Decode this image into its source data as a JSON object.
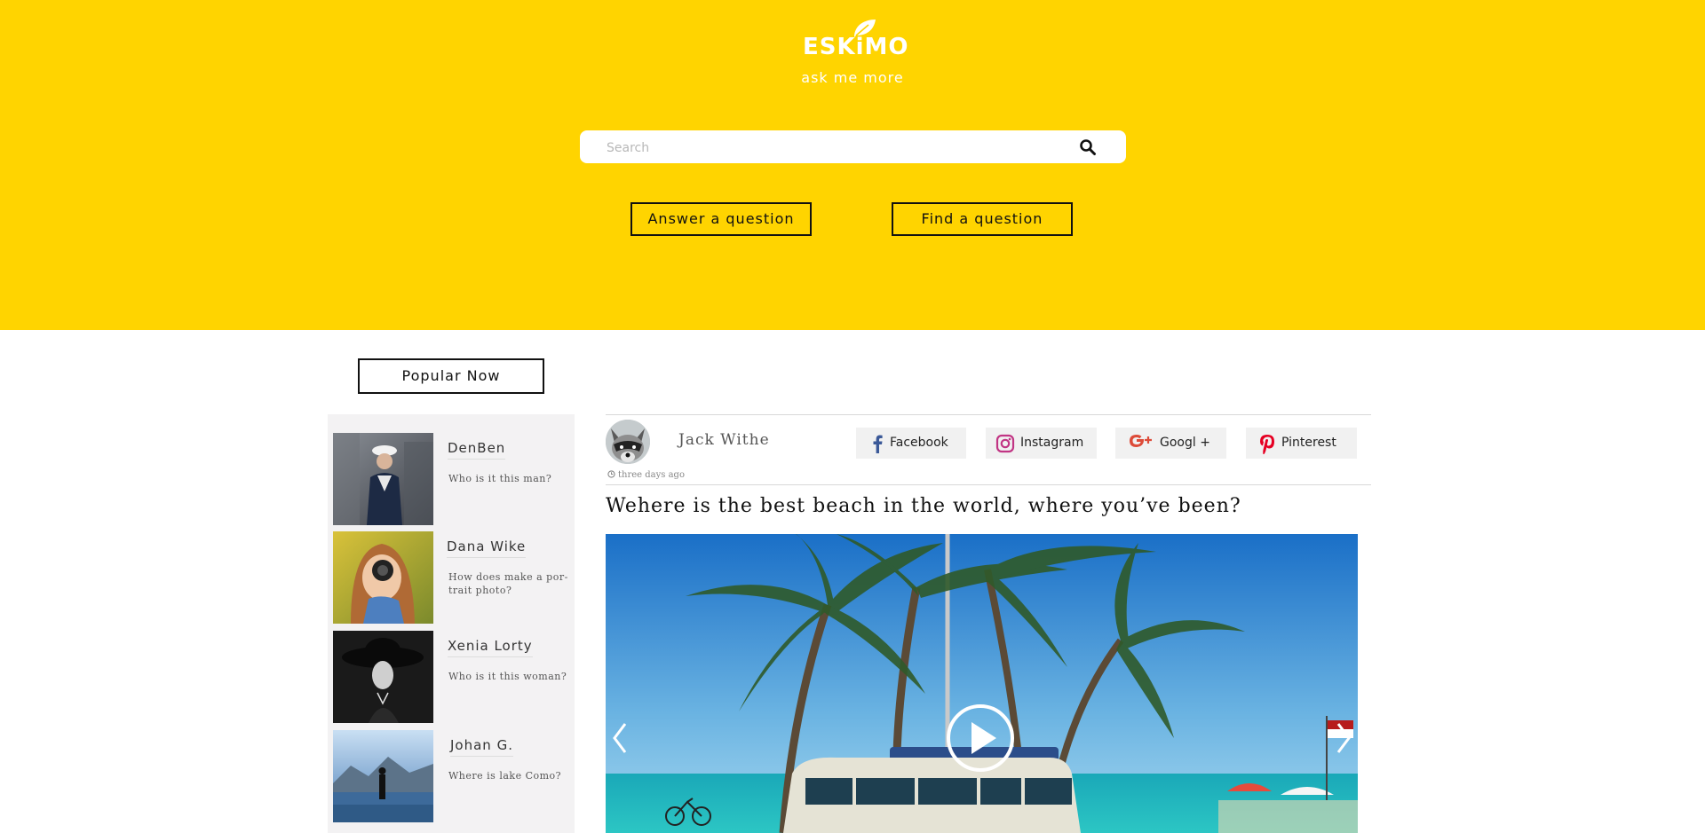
{
  "header": {
    "logo_text": "ESKiMO",
    "tagline": "ask me more",
    "search_placeholder": "Search",
    "answer_button": "Answer a question",
    "find_button": "Find a question",
    "bg_color": "#ffd400"
  },
  "popular": {
    "button_label": "Popular Now"
  },
  "sidebar": {
    "items": [
      {
        "name": "DenBen",
        "question": "Who is it this man?"
      },
      {
        "name": "Dana Wike",
        "question": "How does make a por-trait photo?"
      },
      {
        "name": "Xenia Lorty",
        "question": "Who is it this woman?"
      },
      {
        "name": "Johan G.",
        "question": "Where is lake Como?"
      }
    ]
  },
  "post": {
    "author": "Jack Withe",
    "time": "three days ago",
    "title": "Wehere is the best beach in the world, where you’ve been?",
    "social": [
      {
        "label": "Facebook",
        "icon": "facebook-icon",
        "color": "#3b5998"
      },
      {
        "label": "Instagram",
        "icon": "instagram-icon",
        "color": "#c13584"
      },
      {
        "label": "Googl +",
        "icon": "google-plus-icon",
        "color": "#dd4b39"
      },
      {
        "label": "Pinterest",
        "icon": "pinterest-icon",
        "color": "#e60023"
      }
    ]
  }
}
